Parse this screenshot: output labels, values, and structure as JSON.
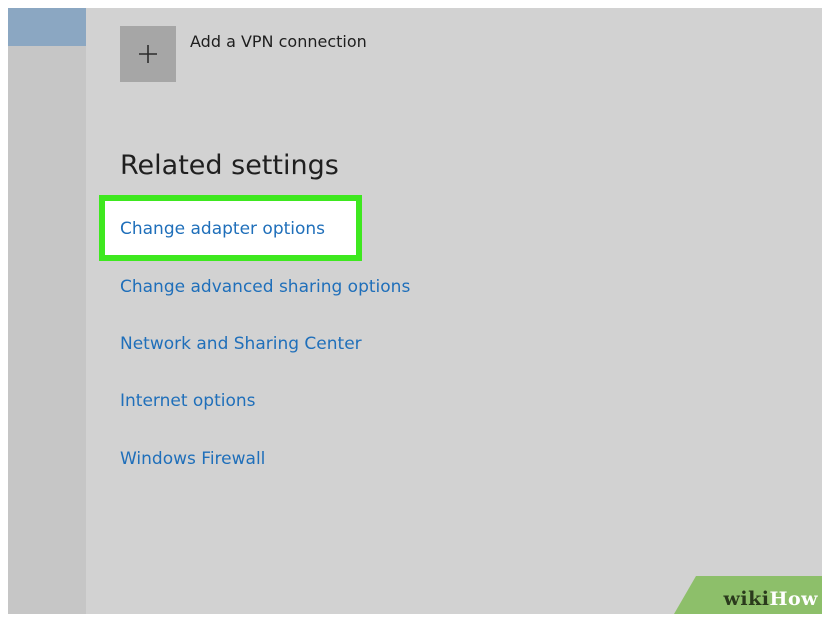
{
  "vpn": {
    "add_label": "Add a VPN connection",
    "add_icon": "plus-icon"
  },
  "related": {
    "title": "Related settings",
    "links": [
      {
        "label": "Change adapter options",
        "highlighted": true
      },
      {
        "label": "Change advanced sharing options"
      },
      {
        "label": "Network and Sharing Center"
      },
      {
        "label": "Internet options"
      },
      {
        "label": "Windows Firewall"
      }
    ]
  },
  "watermark": {
    "part1": "wiki",
    "part2": "How"
  },
  "colors": {
    "background": "#d2d2d2",
    "link": "#1f6fba",
    "highlight_border": "#3ee81f",
    "watermark_green": "#8dbf6a"
  }
}
